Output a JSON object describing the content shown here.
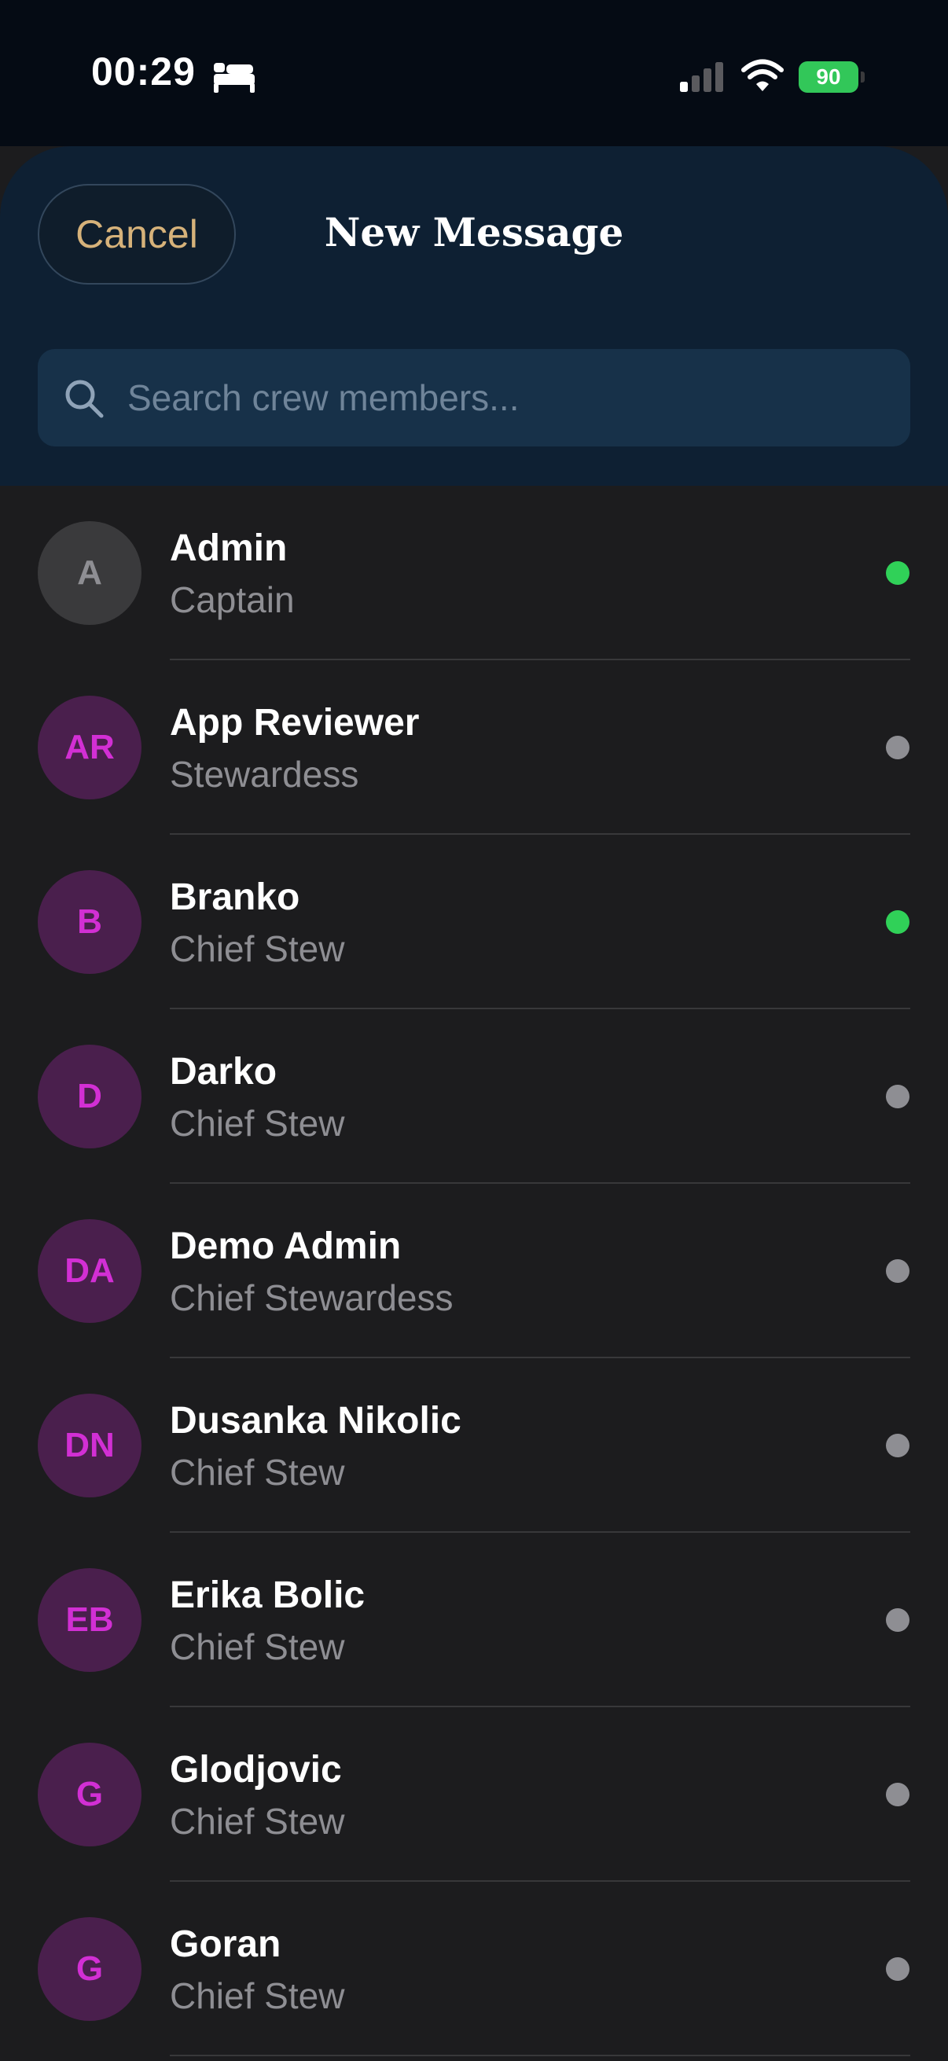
{
  "status_bar": {
    "time": "00:29",
    "battery_level": "90",
    "icons": [
      "sleep-focus-icon",
      "cellular-signal-icon",
      "wifi-icon",
      "battery-charging-icon"
    ]
  },
  "header": {
    "cancel_label": "Cancel",
    "title": "New Message"
  },
  "search": {
    "value": "",
    "placeholder": "Search crew members..."
  },
  "colors": {
    "accent": "#d6b27a",
    "online": "#30d158",
    "offline": "#8e8e93",
    "avatar_background": "#4a1f4d",
    "avatar_text": "#d22fd4",
    "header_background": "#0e2033",
    "list_background": "#1c1c1e"
  },
  "crew": [
    {
      "initials": "A",
      "name": "Admin",
      "role": "Captain",
      "status": "online"
    },
    {
      "initials": "AR",
      "name": "App Reviewer",
      "role": "Stewardess",
      "status": "offline"
    },
    {
      "initials": "B",
      "name": "Branko",
      "role": "Chief Stew",
      "status": "online"
    },
    {
      "initials": "D",
      "name": "Darko",
      "role": "Chief Stew",
      "status": "offline"
    },
    {
      "initials": "DA",
      "name": "Demo Admin",
      "role": "Chief Stewardess",
      "status": "offline"
    },
    {
      "initials": "DN",
      "name": "Dusanka Nikolic",
      "role": "Chief Stew",
      "status": "offline"
    },
    {
      "initials": "EB",
      "name": "Erika Bolic",
      "role": "Chief Stew",
      "status": "offline"
    },
    {
      "initials": "G",
      "name": "Glodjovic",
      "role": "Chief Stew",
      "status": "offline"
    },
    {
      "initials": "G",
      "name": "Goran",
      "role": "Chief Stew",
      "status": "offline"
    }
  ]
}
